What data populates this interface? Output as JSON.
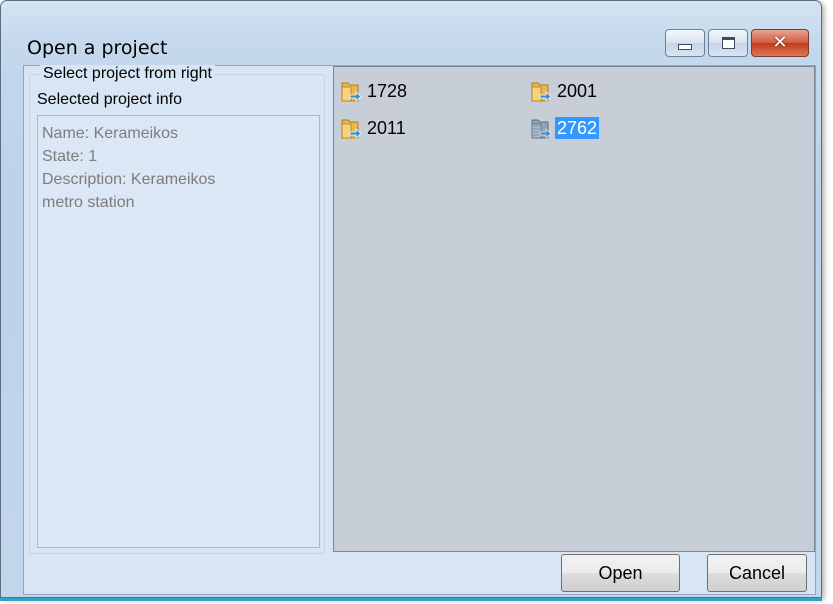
{
  "window": {
    "title": "Open a project"
  },
  "caption_buttons": {
    "minimize": "minimize",
    "maximize": "maximize",
    "close": "close"
  },
  "left_panel": {
    "group_label": "Select project from right",
    "info_label": "Selected project info",
    "info_lines": [
      "Name: Kerameikos",
      "State: 1",
      "Description: Kerameikos",
      "metro station"
    ]
  },
  "projects": [
    {
      "label": "1728",
      "icon": "folder-shortcut-icon",
      "selected": false
    },
    {
      "label": "2001",
      "icon": "folder-shortcut-icon",
      "selected": false
    },
    {
      "label": "2011",
      "icon": "folder-shortcut-icon",
      "selected": false
    },
    {
      "label": "2762",
      "icon": "folder-shortcut-icon",
      "selected": true
    }
  ],
  "buttons": {
    "open": "Open",
    "cancel": "Cancel"
  },
  "colors": {
    "selection": "#3399ff",
    "list_background": "#c8ced7",
    "close_button": "#c23a1a"
  }
}
